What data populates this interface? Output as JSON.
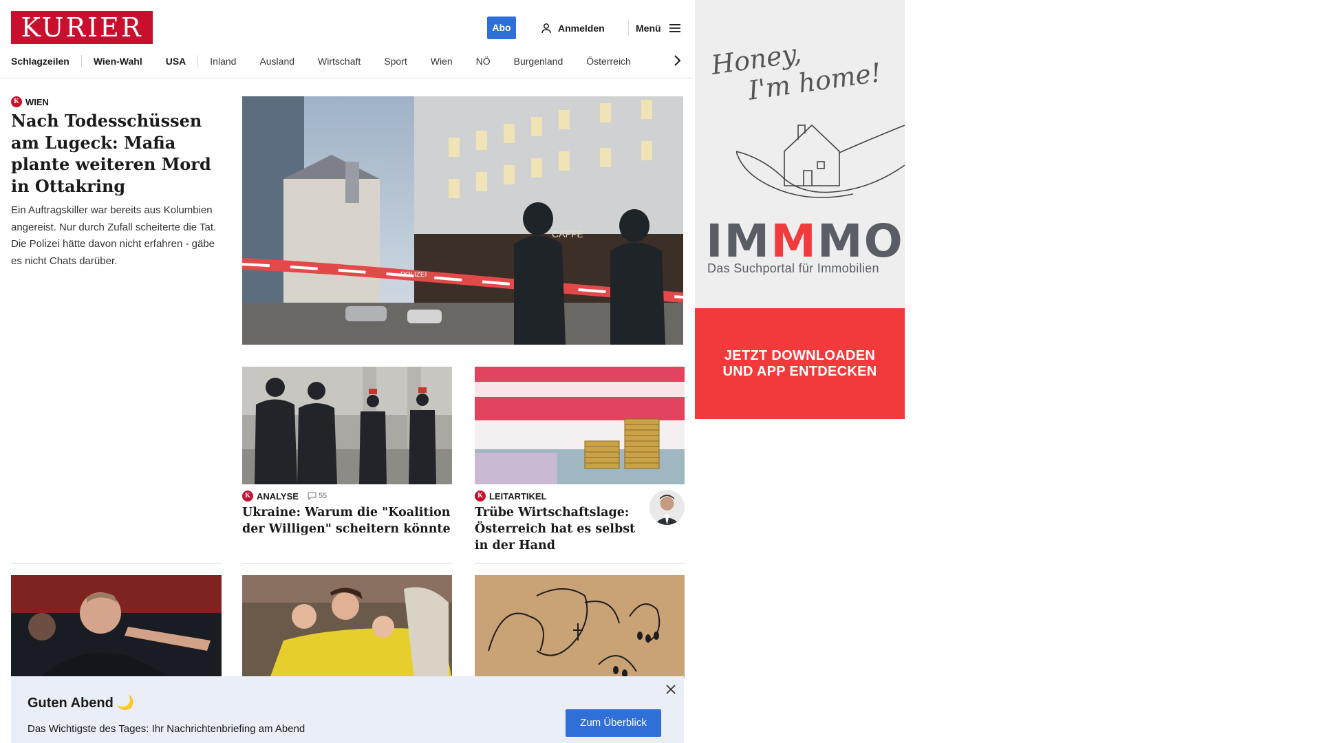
{
  "header": {
    "logo": "KURIER",
    "abo_label": "Abo",
    "login_label": "Anmelden",
    "menu_label": "Menü"
  },
  "nav": {
    "items": [
      "Schlagzeilen",
      "Wien-Wahl",
      "USA",
      "Inland",
      "Ausland",
      "Wirtschaft",
      "Sport",
      "Wien",
      "NÖ",
      "Burgenland",
      "Österreich"
    ]
  },
  "lead": {
    "kicker": "Wien",
    "title": "Nach Todesschüssen am Lugeck: Mafia plante weiteren Mord in Ottakring",
    "teaser": "Ein Auftragskiller war bereits aus Kolumbien angereist. Nur durch Zufall scheiterte die Tat. Die Polizei hätte davon nicht erfahren - gäbe es nicht Chats darüber.",
    "image_text_1": "CAFFE",
    "image_text_2": "POLIZEI"
  },
  "cards": [
    {
      "kicker": "Analyse",
      "comments": "55",
      "title": "Ukraine: Warum die \"Koalition der Willigen\" scheitern könnte"
    },
    {
      "kicker": "Leitartikel",
      "title": "Trübe Wirtschaftslage: Österreich hat es selbst in der Hand"
    }
  ],
  "badge_letter": "K",
  "ad": {
    "script_line_1": "Honey,",
    "script_line_2": "I'm home!",
    "brand_a": "IM",
    "brand_b": "M",
    "brand_c": "MO",
    "subtitle": "Das Suchportal für Immobilien",
    "cta_line_1": "JETZT DOWNLOADEN",
    "cta_line_2": "UND APP ENTDECKEN"
  },
  "banner": {
    "title": "Guten Abend 🌙",
    "text": "Das Wichtigste des Tages: Ihr Nachrichtenbriefing am Abend",
    "button": "Zum Überblick"
  },
  "colors": {
    "brand_red": "#c8102e",
    "button_blue": "#2f6fd8",
    "ad_red": "#f23a3c",
    "banner_bg": "#e9eef7"
  }
}
